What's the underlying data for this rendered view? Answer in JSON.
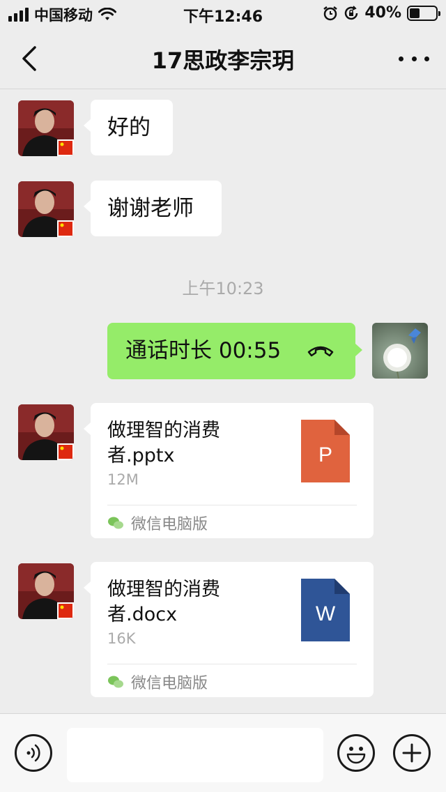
{
  "status_bar": {
    "carrier": "中国移动",
    "time": "下午12:46",
    "battery_text": "40%",
    "battery_level": 0.4
  },
  "nav": {
    "title": "17思政李宗玥",
    "back_icon": "chevron-left-icon",
    "more_icon": "more-dots-icon"
  },
  "messages": {
    "m1": {
      "text": "好的"
    },
    "m2": {
      "text": "谢谢老师"
    },
    "time_separator": "上午10:23",
    "call": {
      "text": "通话时长 00:55",
      "icon": "phone-hangup-icon"
    },
    "file1": {
      "name": "做理智的消费者.pptx",
      "size": "12M",
      "source": "微信电脑版",
      "type_letter": "P",
      "color": "#e0633e"
    },
    "file2": {
      "name": "做理智的消费者.docx",
      "size": "16K",
      "source": "微信电脑版",
      "type_letter": "W",
      "color": "#2f5597"
    }
  },
  "input_bar": {
    "voice_icon": "voice-icon",
    "emoji_icon": "emoji-icon",
    "add_icon": "plus-icon"
  },
  "colors": {
    "background": "#ededed",
    "self_bubble": "#95ec69",
    "other_bubble": "#ffffff"
  }
}
